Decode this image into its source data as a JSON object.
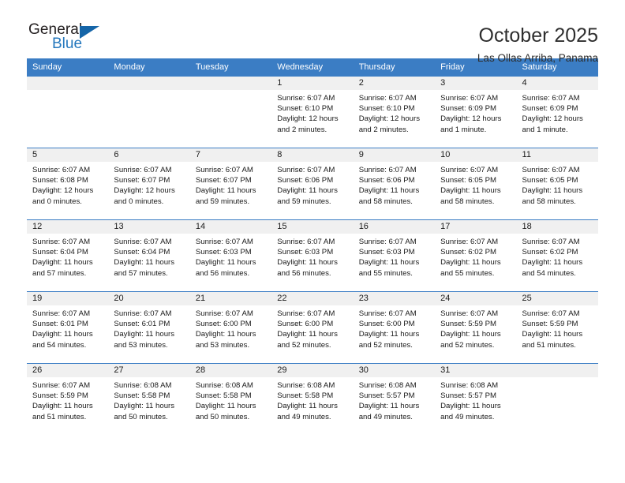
{
  "brand": {
    "name_top": "General",
    "name_bottom": "Blue",
    "triangle_color": "#1565a8",
    "blue_text_color": "#2477bd"
  },
  "header": {
    "title": "October 2025",
    "subtitle": "Las Ollas Arriba, Panama"
  },
  "colors": {
    "header_band": "#3b7dc4",
    "daynum_band": "#f0f0f0",
    "grid_line": "#3b7dc4",
    "text": "#1a1a1a",
    "page_background": "#ffffff"
  },
  "weekday_headers": [
    "Sunday",
    "Monday",
    "Tuesday",
    "Wednesday",
    "Thursday",
    "Friday",
    "Saturday"
  ],
  "weeks": [
    [
      {
        "empty": true,
        "day": "",
        "sunrise": "",
        "sunset": "",
        "daylight_1": "",
        "daylight_2": ""
      },
      {
        "empty": true,
        "day": "",
        "sunrise": "",
        "sunset": "",
        "daylight_1": "",
        "daylight_2": ""
      },
      {
        "empty": true,
        "day": "",
        "sunrise": "",
        "sunset": "",
        "daylight_1": "",
        "daylight_2": ""
      },
      {
        "empty": false,
        "day": "1",
        "sunrise": "Sunrise: 6:07 AM",
        "sunset": "Sunset: 6:10 PM",
        "daylight_1": "Daylight: 12 hours",
        "daylight_2": "and 2 minutes."
      },
      {
        "empty": false,
        "day": "2",
        "sunrise": "Sunrise: 6:07 AM",
        "sunset": "Sunset: 6:10 PM",
        "daylight_1": "Daylight: 12 hours",
        "daylight_2": "and 2 minutes."
      },
      {
        "empty": false,
        "day": "3",
        "sunrise": "Sunrise: 6:07 AM",
        "sunset": "Sunset: 6:09 PM",
        "daylight_1": "Daylight: 12 hours",
        "daylight_2": "and 1 minute."
      },
      {
        "empty": false,
        "day": "4",
        "sunrise": "Sunrise: 6:07 AM",
        "sunset": "Sunset: 6:09 PM",
        "daylight_1": "Daylight: 12 hours",
        "daylight_2": "and 1 minute."
      }
    ],
    [
      {
        "empty": false,
        "day": "5",
        "sunrise": "Sunrise: 6:07 AM",
        "sunset": "Sunset: 6:08 PM",
        "daylight_1": "Daylight: 12 hours",
        "daylight_2": "and 0 minutes."
      },
      {
        "empty": false,
        "day": "6",
        "sunrise": "Sunrise: 6:07 AM",
        "sunset": "Sunset: 6:07 PM",
        "daylight_1": "Daylight: 12 hours",
        "daylight_2": "and 0 minutes."
      },
      {
        "empty": false,
        "day": "7",
        "sunrise": "Sunrise: 6:07 AM",
        "sunset": "Sunset: 6:07 PM",
        "daylight_1": "Daylight: 11 hours",
        "daylight_2": "and 59 minutes."
      },
      {
        "empty": false,
        "day": "8",
        "sunrise": "Sunrise: 6:07 AM",
        "sunset": "Sunset: 6:06 PM",
        "daylight_1": "Daylight: 11 hours",
        "daylight_2": "and 59 minutes."
      },
      {
        "empty": false,
        "day": "9",
        "sunrise": "Sunrise: 6:07 AM",
        "sunset": "Sunset: 6:06 PM",
        "daylight_1": "Daylight: 11 hours",
        "daylight_2": "and 58 minutes."
      },
      {
        "empty": false,
        "day": "10",
        "sunrise": "Sunrise: 6:07 AM",
        "sunset": "Sunset: 6:05 PM",
        "daylight_1": "Daylight: 11 hours",
        "daylight_2": "and 58 minutes."
      },
      {
        "empty": false,
        "day": "11",
        "sunrise": "Sunrise: 6:07 AM",
        "sunset": "Sunset: 6:05 PM",
        "daylight_1": "Daylight: 11 hours",
        "daylight_2": "and 58 minutes."
      }
    ],
    [
      {
        "empty": false,
        "day": "12",
        "sunrise": "Sunrise: 6:07 AM",
        "sunset": "Sunset: 6:04 PM",
        "daylight_1": "Daylight: 11 hours",
        "daylight_2": "and 57 minutes."
      },
      {
        "empty": false,
        "day": "13",
        "sunrise": "Sunrise: 6:07 AM",
        "sunset": "Sunset: 6:04 PM",
        "daylight_1": "Daylight: 11 hours",
        "daylight_2": "and 57 minutes."
      },
      {
        "empty": false,
        "day": "14",
        "sunrise": "Sunrise: 6:07 AM",
        "sunset": "Sunset: 6:03 PM",
        "daylight_1": "Daylight: 11 hours",
        "daylight_2": "and 56 minutes."
      },
      {
        "empty": false,
        "day": "15",
        "sunrise": "Sunrise: 6:07 AM",
        "sunset": "Sunset: 6:03 PM",
        "daylight_1": "Daylight: 11 hours",
        "daylight_2": "and 56 minutes."
      },
      {
        "empty": false,
        "day": "16",
        "sunrise": "Sunrise: 6:07 AM",
        "sunset": "Sunset: 6:03 PM",
        "daylight_1": "Daylight: 11 hours",
        "daylight_2": "and 55 minutes."
      },
      {
        "empty": false,
        "day": "17",
        "sunrise": "Sunrise: 6:07 AM",
        "sunset": "Sunset: 6:02 PM",
        "daylight_1": "Daylight: 11 hours",
        "daylight_2": "and 55 minutes."
      },
      {
        "empty": false,
        "day": "18",
        "sunrise": "Sunrise: 6:07 AM",
        "sunset": "Sunset: 6:02 PM",
        "daylight_1": "Daylight: 11 hours",
        "daylight_2": "and 54 minutes."
      }
    ],
    [
      {
        "empty": false,
        "day": "19",
        "sunrise": "Sunrise: 6:07 AM",
        "sunset": "Sunset: 6:01 PM",
        "daylight_1": "Daylight: 11 hours",
        "daylight_2": "and 54 minutes."
      },
      {
        "empty": false,
        "day": "20",
        "sunrise": "Sunrise: 6:07 AM",
        "sunset": "Sunset: 6:01 PM",
        "daylight_1": "Daylight: 11 hours",
        "daylight_2": "and 53 minutes."
      },
      {
        "empty": false,
        "day": "21",
        "sunrise": "Sunrise: 6:07 AM",
        "sunset": "Sunset: 6:00 PM",
        "daylight_1": "Daylight: 11 hours",
        "daylight_2": "and 53 minutes."
      },
      {
        "empty": false,
        "day": "22",
        "sunrise": "Sunrise: 6:07 AM",
        "sunset": "Sunset: 6:00 PM",
        "daylight_1": "Daylight: 11 hours",
        "daylight_2": "and 52 minutes."
      },
      {
        "empty": false,
        "day": "23",
        "sunrise": "Sunrise: 6:07 AM",
        "sunset": "Sunset: 6:00 PM",
        "daylight_1": "Daylight: 11 hours",
        "daylight_2": "and 52 minutes."
      },
      {
        "empty": false,
        "day": "24",
        "sunrise": "Sunrise: 6:07 AM",
        "sunset": "Sunset: 5:59 PM",
        "daylight_1": "Daylight: 11 hours",
        "daylight_2": "and 52 minutes."
      },
      {
        "empty": false,
        "day": "25",
        "sunrise": "Sunrise: 6:07 AM",
        "sunset": "Sunset: 5:59 PM",
        "daylight_1": "Daylight: 11 hours",
        "daylight_2": "and 51 minutes."
      }
    ],
    [
      {
        "empty": false,
        "day": "26",
        "sunrise": "Sunrise: 6:07 AM",
        "sunset": "Sunset: 5:59 PM",
        "daylight_1": "Daylight: 11 hours",
        "daylight_2": "and 51 minutes."
      },
      {
        "empty": false,
        "day": "27",
        "sunrise": "Sunrise: 6:08 AM",
        "sunset": "Sunset: 5:58 PM",
        "daylight_1": "Daylight: 11 hours",
        "daylight_2": "and 50 minutes."
      },
      {
        "empty": false,
        "day": "28",
        "sunrise": "Sunrise: 6:08 AM",
        "sunset": "Sunset: 5:58 PM",
        "daylight_1": "Daylight: 11 hours",
        "daylight_2": "and 50 minutes."
      },
      {
        "empty": false,
        "day": "29",
        "sunrise": "Sunrise: 6:08 AM",
        "sunset": "Sunset: 5:58 PM",
        "daylight_1": "Daylight: 11 hours",
        "daylight_2": "and 49 minutes."
      },
      {
        "empty": false,
        "day": "30",
        "sunrise": "Sunrise: 6:08 AM",
        "sunset": "Sunset: 5:57 PM",
        "daylight_1": "Daylight: 11 hours",
        "daylight_2": "and 49 minutes."
      },
      {
        "empty": false,
        "day": "31",
        "sunrise": "Sunrise: 6:08 AM",
        "sunset": "Sunset: 5:57 PM",
        "daylight_1": "Daylight: 11 hours",
        "daylight_2": "and 49 minutes."
      },
      {
        "empty": true,
        "day": "",
        "sunrise": "",
        "sunset": "",
        "daylight_1": "",
        "daylight_2": ""
      }
    ]
  ]
}
